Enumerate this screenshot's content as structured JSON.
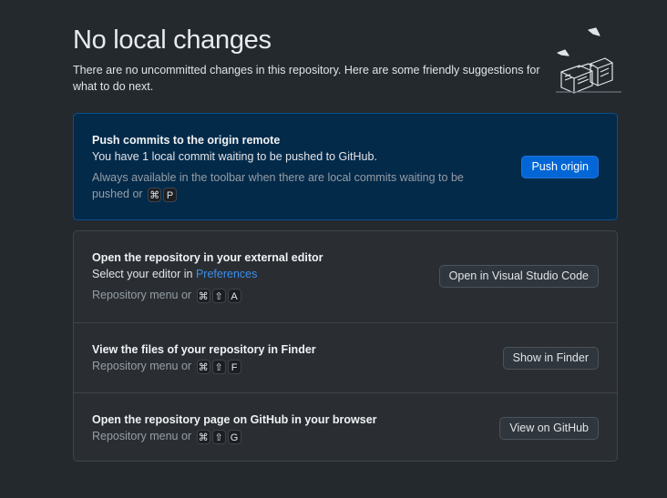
{
  "header": {
    "title": "No local changes",
    "subtitle": "There are no uncommitted changes in this repository. Here are some friendly suggestions for what to do next."
  },
  "push": {
    "title": "Push commits to the origin remote",
    "description": "You have 1 local commit waiting to be pushed to GitHub.",
    "hint": "Always available in the toolbar when there are local commits waiting to be pushed or",
    "keys": [
      "⌘",
      "P"
    ],
    "button": "Push origin"
  },
  "editor": {
    "title": "Open the repository in your external editor",
    "description_prefix": "Select your editor in",
    "description_link": "Preferences",
    "hint": "Repository menu or",
    "keys": [
      "⌘",
      "⇧",
      "A"
    ],
    "button": "Open in Visual Studio Code"
  },
  "finder": {
    "title": "View the files of your repository in Finder",
    "hint": "Repository menu or",
    "keys": [
      "⌘",
      "⇧",
      "F"
    ],
    "button": "Show in Finder"
  },
  "github": {
    "title": "Open the repository page on GitHub in your browser",
    "hint": "Repository menu or",
    "keys": [
      "⌘",
      "⇧",
      "G"
    ],
    "button": "View on GitHub"
  },
  "colors": {
    "background": "#24292e",
    "primary_card": "#042a4a",
    "accent_blue": "#0366d6",
    "link": "#3b8eea"
  }
}
